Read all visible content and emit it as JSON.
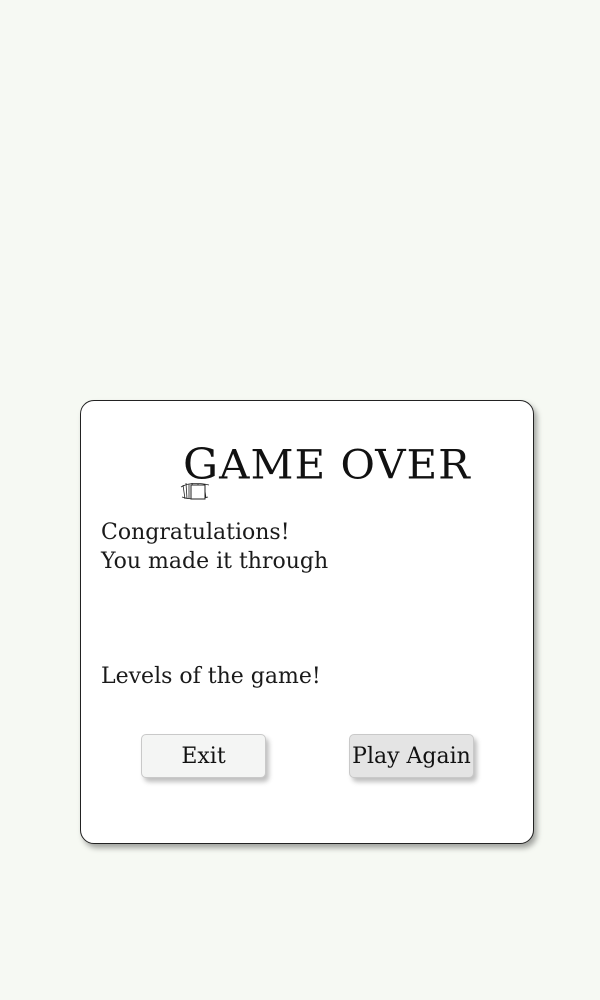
{
  "dialog": {
    "title": "GAME OVER",
    "message_line_1": "Congratulations!",
    "message_line_2": "You made it through",
    "message_line_3": "Levels of the game!",
    "exit_label": "Exit",
    "play_again_label": "Play Again"
  },
  "colors": {
    "background": "#f6f9f3",
    "dialog_bg": "#ffffff",
    "dialog_border": "#222222",
    "exit_bg": "#f4f5f4",
    "play_again_bg": "#e4e4e4"
  }
}
